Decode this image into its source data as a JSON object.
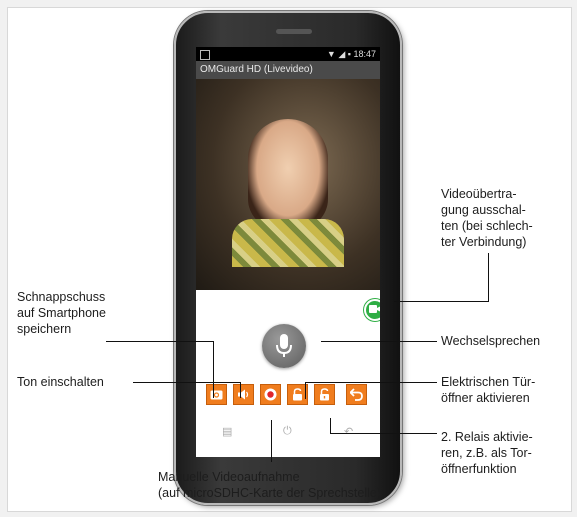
{
  "app": {
    "status_time": "18:47",
    "status_icons": "▼ ◢ ▪",
    "title": "OMGuard HD (Livevideo)"
  },
  "buttons": [
    {
      "name": "snapshot-button",
      "icon": "camera-icon"
    },
    {
      "name": "sound-button",
      "icon": "speaker-icon"
    },
    {
      "name": "record-button",
      "icon": "record-icon"
    },
    {
      "name": "door-opener-button",
      "icon": "unlock-icon"
    },
    {
      "name": "relay-2-button",
      "icon": "unlock-2-icon"
    },
    {
      "name": "back-button",
      "icon": "back-arrow-icon"
    }
  ],
  "labels": {
    "video_off": [
      "Videoübertra-",
      "gung ausschal-",
      "ten (bei schlech-",
      "ter Verbindung)"
    ],
    "snapshot": [
      "Schnappschuss",
      "auf Smartphone",
      "speichern"
    ],
    "intercom": "Wechselsprechen",
    "sound": "Ton einschalten",
    "door": [
      "Elektrischen Tür-",
      "öffner aktivieren"
    ],
    "relay": [
      "2. Relais aktivie-",
      "ren, z.B. als Tor-",
      "öffnerfunktion"
    ],
    "record": [
      "Manuelle Videoaufnahme",
      "(auf microSDHC-Karte der Sprechstelle)"
    ]
  },
  "colors": {
    "button_orange": "#f07d1e",
    "cam_green": "#2fae45",
    "record_red": "#e0252b"
  }
}
